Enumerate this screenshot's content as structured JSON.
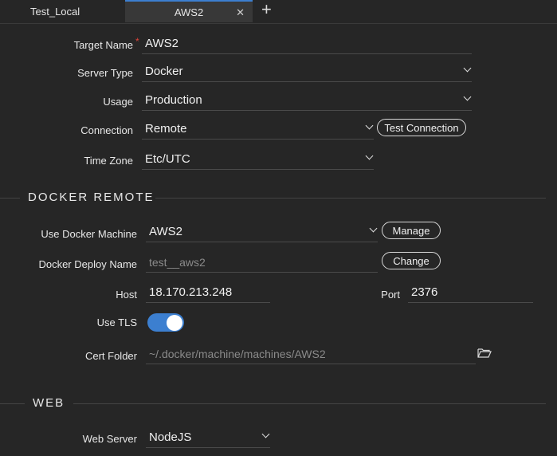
{
  "tabs": [
    {
      "label": "Test_Local"
    },
    {
      "label": "AWS2"
    }
  ],
  "form": {
    "target_name": {
      "label": "Target Name",
      "value": "AWS2",
      "required_mark": "*"
    },
    "server_type": {
      "label": "Server Type",
      "value": "Docker"
    },
    "usage": {
      "label": "Usage",
      "value": "Production"
    },
    "connection": {
      "label": "Connection",
      "value": "Remote",
      "button": "Test Connection"
    },
    "time_zone": {
      "label": "Time Zone",
      "value": "Etc/UTC"
    }
  },
  "docker_remote": {
    "title": "DOCKER REMOTE",
    "machine": {
      "label": "Use Docker Machine",
      "value": "AWS2",
      "button": "Manage"
    },
    "deploy_name": {
      "label": "Docker Deploy Name",
      "value": "test__aws2",
      "button": "Change"
    },
    "host": {
      "label": "Host",
      "value": "18.170.213.248"
    },
    "port": {
      "label": "Port",
      "value": "2376"
    },
    "tls": {
      "label": "Use TLS",
      "enabled": true
    },
    "cert_folder": {
      "label": "Cert Folder",
      "value": "~/.docker/machine/machines/AWS2",
      "icon": "folder-open-icon"
    }
  },
  "web": {
    "title": "WEB",
    "web_server": {
      "label": "Web Server",
      "value": "NodeJS"
    }
  },
  "colors": {
    "accent": "#3c7fd0",
    "background": "#262626",
    "required": "#e0443a"
  }
}
